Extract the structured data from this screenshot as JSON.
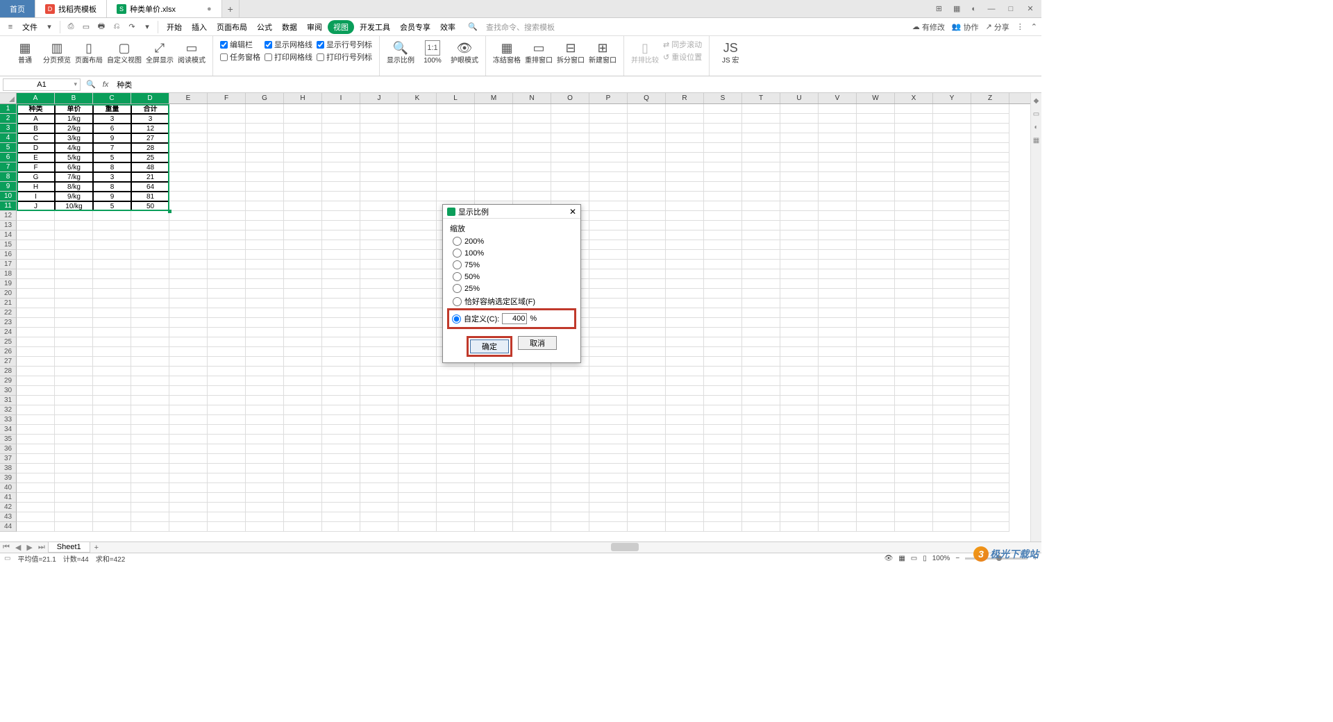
{
  "tabs": {
    "home": "首页",
    "template": "找稻壳模板",
    "file": "种类单价.xlsx",
    "dirty": "●",
    "add": "+"
  },
  "win": {
    "grid": "⊞",
    "apps": "▦",
    "user": "◐",
    "min": "—",
    "max": "□",
    "close": "✕"
  },
  "menu": {
    "burger": "≡",
    "file": "文件",
    "drop": "▾",
    "qat": [
      "⎙",
      "▭",
      "🖶",
      "⎌",
      "↷",
      "▾"
    ],
    "items": [
      "开始",
      "插入",
      "页面布局",
      "公式",
      "数据",
      "审阅",
      "视图",
      "开发工具",
      "会员专享",
      "效率"
    ],
    "active_idx": 6,
    "search_icon": "🔍",
    "search": "查找命令、搜索模板",
    "right": {
      "cloud": "☁",
      "cloud_t": "有修改",
      "coop": "👥",
      "coop_t": "协作",
      "share": "↗",
      "share_t": "分享",
      "more": "⋮",
      "chev": "⌃"
    }
  },
  "ribbon": {
    "g1": [
      {
        "icon": "▦",
        "lbl": "普通"
      },
      {
        "icon": "▥",
        "lbl": "分页预览"
      },
      {
        "icon": "▯",
        "lbl": "页面布局"
      },
      {
        "icon": "▢",
        "lbl": "自定义视图"
      },
      {
        "icon": "⤢",
        "lbl": "全屏显示"
      },
      {
        "icon": "▭",
        "lbl": "阅读模式"
      }
    ],
    "checks1": [
      {
        "c": true,
        "t": "编辑栏"
      },
      {
        "c": false,
        "t": "任务窗格"
      }
    ],
    "checks2": [
      {
        "c": true,
        "t": "显示网格线"
      },
      {
        "c": false,
        "t": "打印网格线"
      }
    ],
    "checks3": [
      {
        "c": true,
        "t": "显示行号列标"
      },
      {
        "c": false,
        "t": "打印行号列标"
      }
    ],
    "g2": [
      {
        "icon": "🔍",
        "lbl": "显示比例"
      },
      {
        "icon": "1:1",
        "lbl": "100%",
        "boxed": true
      },
      {
        "icon": "👁",
        "lbl": "护眼模式"
      }
    ],
    "g3": [
      {
        "icon": "▦",
        "lbl": "冻结窗格"
      },
      {
        "icon": "▭",
        "lbl": "重排窗口"
      },
      {
        "icon": "⊟",
        "lbl": "拆分窗口"
      },
      {
        "icon": "⊞",
        "lbl": "新建窗口"
      }
    ],
    "g4": [
      {
        "icon": "▯",
        "lbl": "并排比较",
        "dis": true
      },
      {
        "icon": "⇄",
        "lbl": "同步滚动",
        "dis": true,
        "inline": true
      },
      {
        "icon": "↺",
        "lbl": "重设位置",
        "dis": true,
        "inline": true
      }
    ],
    "g5": [
      {
        "icon": "JS",
        "lbl": "JS 宏"
      }
    ]
  },
  "fbar": {
    "name": "A1",
    "mag": "🔍",
    "fx": "fx",
    "val": "种类"
  },
  "cols": [
    "A",
    "B",
    "C",
    "D",
    "E",
    "F",
    "G",
    "H",
    "I",
    "J",
    "K",
    "L",
    "M",
    "N",
    "O",
    "P",
    "Q",
    "R",
    "S",
    "T",
    "U",
    "V",
    "W",
    "X",
    "Y",
    "Z"
  ],
  "data": {
    "headers": [
      "种类",
      "单价",
      "重量",
      "合计"
    ],
    "rows": [
      [
        "A",
        "1/kg",
        "3",
        "3"
      ],
      [
        "B",
        "2/kg",
        "6",
        "12"
      ],
      [
        "C",
        "3/kg",
        "9",
        "27"
      ],
      [
        "D",
        "4/kg",
        "7",
        "28"
      ],
      [
        "E",
        "5/kg",
        "5",
        "25"
      ],
      [
        "F",
        "6/kg",
        "8",
        "48"
      ],
      [
        "G",
        "7/kg",
        "3",
        "21"
      ],
      [
        "H",
        "8/kg",
        "8",
        "64"
      ],
      [
        "I",
        "9/kg",
        "9",
        "81"
      ],
      [
        "J",
        "10/kg",
        "5",
        "50"
      ]
    ]
  },
  "sheets": {
    "nav": [
      "⏮",
      "◀",
      "▶",
      "⏭"
    ],
    "tab": "Sheet1",
    "add": "+"
  },
  "status": {
    "icon": "▭",
    "avg": "平均值=21.1",
    "count": "计数=44",
    "sum": "求和=422",
    "right": {
      "eye": "👁",
      "grid": "▦",
      "square": "▭",
      "col": "▯",
      "zoom": "100%",
      "minus": "−",
      "plus": "+"
    }
  },
  "dialog": {
    "title": "显示比例",
    "close": "✕",
    "group": "缩放",
    "opts": [
      "200%",
      "100%",
      "75%",
      "50%",
      "25%",
      "恰好容纳选定区域(F)"
    ],
    "custom_lbl": "自定义(C):",
    "custom_val": "400",
    "pct": "%",
    "ok": "确定",
    "cancel": "取消"
  },
  "watermark": {
    "icon": "3",
    "text": "极光下载站",
    "icons": "🔵🟢🔴"
  }
}
